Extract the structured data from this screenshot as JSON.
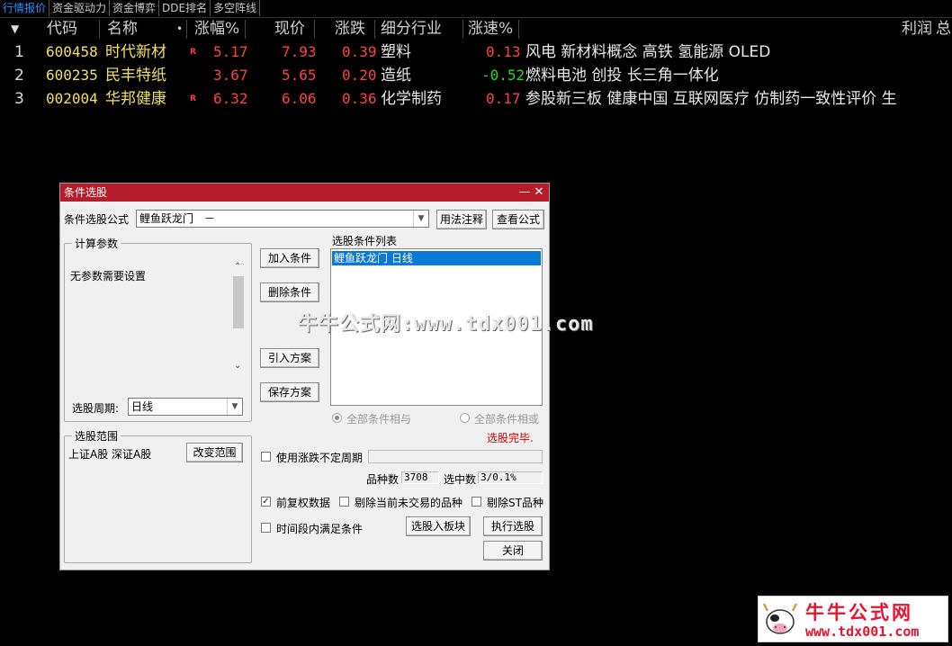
{
  "tabs": [
    "行情报价",
    "资金驱动力",
    "资金博弈",
    "DDE排名",
    "多空阵线"
  ],
  "header": {
    "sort_arrow": "▼",
    "cols": [
      "代码",
      "名称",
      "涨幅%",
      "现价",
      "涨跌",
      "细分行业",
      "涨速%",
      "利润"
    ],
    "dot": "•",
    "right_tail": "总"
  },
  "rows": [
    {
      "idx": "1",
      "code": "600458",
      "name": "时代新材",
      "badge": "R",
      "pct": "5.17",
      "price": "7.93",
      "chg": "0.39",
      "industry": "塑料",
      "speed": "0.13",
      "concept": "风电 新材料概念 高铁 氢能源 OLED"
    },
    {
      "idx": "2",
      "code": "600235",
      "name": "民丰特纸",
      "badge": "",
      "pct": "3.67",
      "price": "5.65",
      "chg": "0.20",
      "industry": "造纸",
      "speed": "-0.52",
      "concept": "燃料电池 创投 长三角一体化"
    },
    {
      "idx": "3",
      "code": "002004",
      "name": "华邦健康",
      "badge": "R",
      "pct": "6.32",
      "price": "6.06",
      "chg": "0.36",
      "industry": "化学制药",
      "speed": "0.17",
      "concept": "参股新三板 健康中国 互联网医疗 仿制药一致性评价 生"
    }
  ],
  "dialog": {
    "title": "条件选股",
    "minimize": "—",
    "close": "✕",
    "formula_label": "条件选股公式",
    "formula_value": "鲤鱼跃龙门　－",
    "btn_usage": "用法注释",
    "btn_view": "查看公式",
    "params_legend": "计算参数",
    "params_text": "无参数需要设置",
    "period_label": "选股周期:",
    "period_value": "日线",
    "btn_add": "加入条件",
    "btn_del": "删除条件",
    "btn_import": "引入方案",
    "btn_save": "保存方案",
    "list_label": "选股条件列表",
    "list_items": [
      "鲤鱼跃龙门  日线"
    ],
    "radio_and": "全部条件相与",
    "radio_or": "全部条件相或",
    "status": "选股完毕.",
    "range_legend": "选股范围",
    "range_text": "上证A股  深证A股",
    "btn_range": "改变范围",
    "chk_period": "使用涨跌不定周期",
    "count_label": "品种数",
    "count_value": "3708",
    "selected_label": "选中数",
    "selected_value": "3/0.1%",
    "chk_fq": "前复权数据",
    "chk_notrade": "剔除当前未交易的品种",
    "chk_st": "剔除ST品种",
    "chk_time": "时间段内满足条件",
    "btn_toblock": "选股入板块",
    "btn_run": "执行选股",
    "btn_close": "关闭"
  },
  "watermark": "牛牛公式网:www.tdx001.com",
  "logo": {
    "title": "牛牛公式网",
    "url": "www.tdx001.com"
  },
  "colors": {
    "title_bar": "#b51d2c",
    "up": "#ff4040",
    "down": "#22dd22",
    "code": "#f0e060",
    "tab_active": "#2f8fff",
    "list_select": "#0a78d7"
  }
}
